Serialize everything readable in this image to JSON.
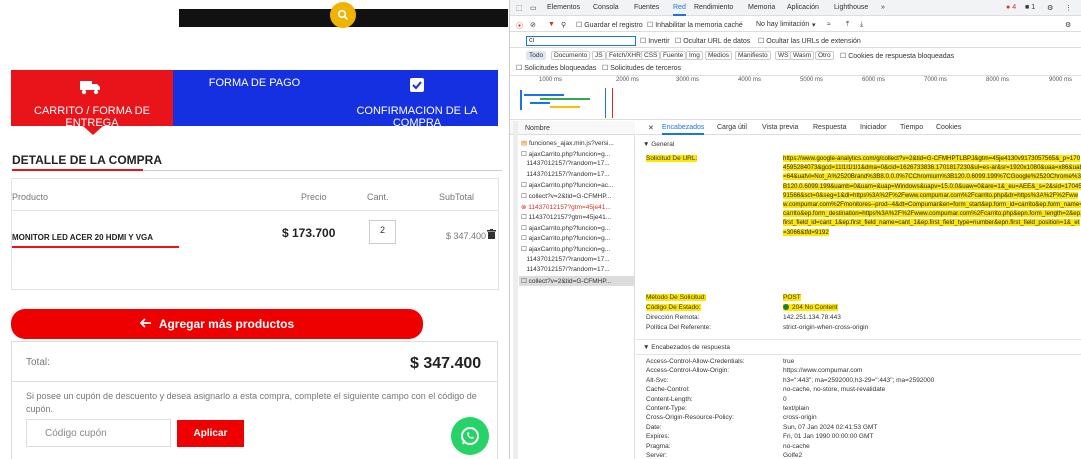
{
  "shop": {
    "steps": [
      {
        "label": "CARRITO / FORMA DE ENTREGA"
      },
      {
        "label": "FORMA DE PAGO"
      },
      {
        "label": "CONFIRMACION DE LA COMPRA"
      }
    ],
    "detail_title": "DETALLE DE LA COMPRA",
    "columns": [
      "Producto",
      "Precio",
      "Cant.",
      "SubTotal"
    ],
    "product": {
      "name": "MONITOR LED ACER 20 HDMI Y VGA",
      "price": "$ 173.700",
      "qty": "2",
      "subtotal": "$ 347.400"
    },
    "add_more_label": "Agregar más productos",
    "total_label": "Total:",
    "total_value": "$ 347.400",
    "coupon_text": "Si posee un cupón de descuento y desea asignarlo a esta compra, complete el siguiente campo con el código de cupón.",
    "coupon_placeholder": "Código cupón",
    "apply_label": "Aplicar",
    "colors": {
      "red": "#e8141a",
      "blue": "#1430e0",
      "whatsapp": "#25d366",
      "search": "#f0b400"
    }
  },
  "devtools": {
    "tabs": [
      "Elementos",
      "Consola",
      "Fuentes",
      "Red",
      "Rendimiento",
      "Memoria",
      "Aplicación",
      "Lighthouse"
    ],
    "active_tab": "Red",
    "badges": {
      "errors": "4",
      "warnings": "1"
    },
    "toolbar": {
      "preserve_log": "Guardar el registro",
      "disable_cache": "Inhabilitar la memoria caché",
      "throttle": "No hay limitación"
    },
    "filter": {
      "value": "ci",
      "invert": "Invertir",
      "hide_data": "Ocultar URL de datos",
      "hide_ext": "Ocultar las URLs de extensión"
    },
    "types": [
      "Todo",
      "Documento",
      "JS",
      "Fetch/XHR",
      "CSS",
      "Fuente",
      "Img",
      "Medios",
      "Manifiesto",
      "WS",
      "Wasm",
      "Otro"
    ],
    "blocked_cookies": "Cookies de respuesta bloqueadas",
    "blocked_requests": "Solicitudes bloqueadas",
    "third_party": "Solicitudes de terceros",
    "timeline_ticks": [
      "1000 ms",
      "2000 ms",
      "3000 ms",
      "4000 ms",
      "5000 ms",
      "6000 ms",
      "7000 ms",
      "8000 ms",
      "9000 ms"
    ],
    "list_header": "Nombre",
    "requests": [
      {
        "name": "funciones_ajax.min.js?versi...",
        "type": "js"
      },
      {
        "name": "ajaxCarrito.php?funcion=g...",
        "type": "doc"
      },
      {
        "name": "11437012157/?random=17...",
        "type": "none"
      },
      {
        "name": "11437012157/?random=17...",
        "type": "none"
      },
      {
        "name": "ajaxCarrito.php?funcion=ac...",
        "type": "doc"
      },
      {
        "name": "collect?v=2&tid=G-CFMHP...",
        "type": "doc"
      },
      {
        "name": "11437012157?gtm=45je41...",
        "type": "err"
      },
      {
        "name": "11437012157?gtm=45je41...",
        "type": "doc"
      },
      {
        "name": "ajaxCarrito.php?funcion=g...",
        "type": "doc"
      },
      {
        "name": "ajaxCarrito.php?funcion=g...",
        "type": "doc"
      },
      {
        "name": "ajaxCarrito.php?funcion=g...",
        "type": "doc"
      },
      {
        "name": "11437012157/?random=17...",
        "type": "none"
      },
      {
        "name": "11437012157/?random=17...",
        "type": "none"
      },
      {
        "name": "collect?v=2&tid=G-CFMHP...",
        "type": "sel"
      }
    ],
    "detail_tabs": [
      "Encabezados",
      "Carga útil",
      "Vista previa",
      "Respuesta",
      "Iniciador",
      "Tiempo",
      "Cookies"
    ],
    "general_title": "▼ General",
    "request_url_label": "Solicitud De URL:",
    "request_url_value": "https://www.google-analytics.com/g/collect?v=2&tid=G-CFMHPTLBPJ&gtm=45je4130v9173057565&_p=1704595284073&gcd=11l1l1l1l1&dma=0&cid=1626733836.1701817230&ul=es-ar&sr=1920x1080&uaa=x86&uab=64&uafvl=Not_A%2520Brand%3B8.0.0.0%7CChromium%3B120.0.6099.199%7CGoogle%2520Chrome%3B120.0.6099.199&uamb=0&uam=&uap=Windows&uapv=15.0.0&uaw=0&are=1&_eu=AEE&_s=2&sid=1704591566&sct=0&seg=1&dl=https%3A%2F%2Fwww.compumar.com%2Fcarrito.php&dr=https%3A%2F%2Fwww.compumar.com%2Fmonitores--prod--4&dt=Compumar&en=form_start&ep.form_id=carrito&ep.form_name=carrito&ep.form_destination=https%3A%2F%2Fwww.compumar.com%2Fcarrito.php&epn.form_length=2&ep.first_field_id=cant_1&ep.first_field_name=cant_1&ep.first_field_type=number&epn.first_field_position=1&_et=3066&tfd=9192",
    "method_label": "Método De Solicitud:",
    "method_value": "POST",
    "status_label": "Código De Estado:",
    "status_value": "204 No Content",
    "remote_label": "Dirección Remota:",
    "remote_value": "142.251.134.78:443",
    "referrer_label": "Política Del Referente:",
    "referrer_value": "strict-origin-when-cross-origin",
    "response_title": "▼ Encabezados de respuesta",
    "response_headers": [
      {
        "k": "Access-Control-Allow-Credentials:",
        "v": "true"
      },
      {
        "k": "Access-Control-Allow-Origin:",
        "v": "https://www.compumar.com"
      },
      {
        "k": "Alt-Svc:",
        "v": "h3=\":443\"; ma=2592000,h3-29=\":443\"; ma=2592000"
      },
      {
        "k": "Cache-Control:",
        "v": "no-cache, no-store, must-revalidate"
      },
      {
        "k": "Content-Length:",
        "v": "0"
      },
      {
        "k": "Content-Type:",
        "v": "text/plain"
      },
      {
        "k": "Cross-Origin-Resource-Policy:",
        "v": "cross-origin"
      },
      {
        "k": "Date:",
        "v": "Sun, 07 Jan 2024 02:41:53 GMT"
      },
      {
        "k": "Expires:",
        "v": "Fri, 01 Jan 1990 00:00:00 GMT"
      },
      {
        "k": "Pragma:",
        "v": "no-cache"
      },
      {
        "k": "Server:",
        "v": "Golfe2"
      }
    ]
  }
}
